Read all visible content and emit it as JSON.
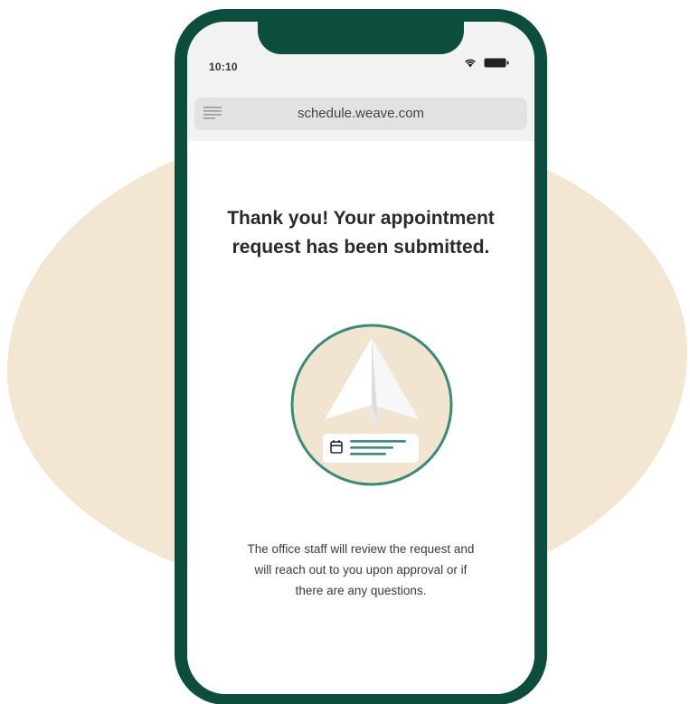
{
  "status_bar": {
    "time": "10:10",
    "wifi_icon": "wifi-icon",
    "battery_icon": "battery-icon"
  },
  "browser": {
    "url": "schedule.weave.com",
    "menu_icon": "menu-icon"
  },
  "main": {
    "headline": "Thank you! Your appointment\nrequest has been submitted.",
    "illustration_icon": "paper-airplane-icon",
    "card_icon": "calendar-icon",
    "body": "The office staff will review the request and\nwill reach out to you upon approval or if\nthere are any questions."
  },
  "colors": {
    "phone_frame": "#0d4d3e",
    "accent": "#3d8a73",
    "background_blob": "#f3e6d2"
  }
}
